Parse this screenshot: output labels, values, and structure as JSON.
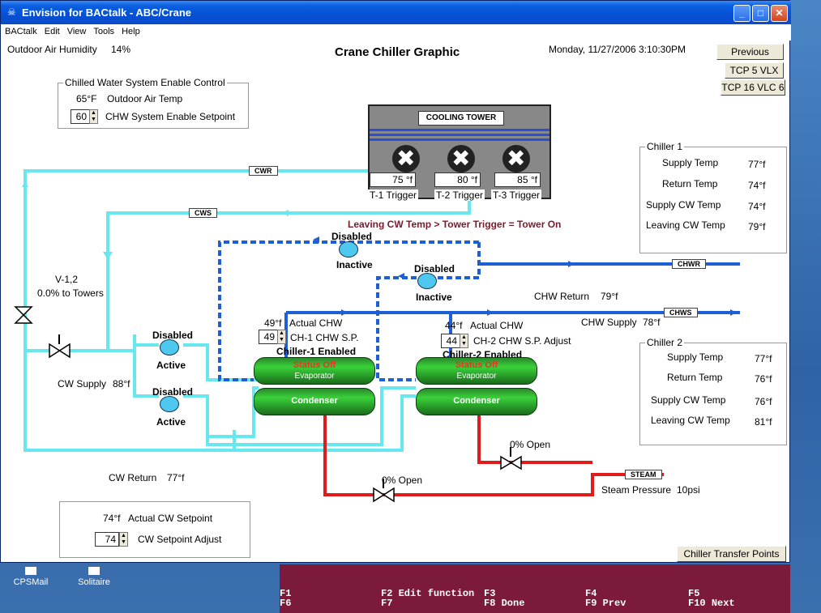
{
  "window": {
    "title": "Envision for BACtalk - ABC/Crane"
  },
  "menu": [
    "BACtalk",
    "Edit",
    "View",
    "Tools",
    "Help"
  ],
  "header": {
    "humidity_label": "Outdoor Air Humidity",
    "humidity_value": "14%",
    "graphic_title": "Crane Chiller Graphic",
    "datetime": "Monday, 11/27/2006  3:10:30PM"
  },
  "nav_buttons": {
    "previous": "Previous",
    "tcp5": "TCP 5 VLX",
    "tcp16": "TCP 16 VLC 6",
    "transfer": "Chiller Transfer Points"
  },
  "enable_control": {
    "legend": "Chilled Water System Enable Control",
    "oat": "65°F",
    "oat_label": "Outdoor Air Temp",
    "setpoint": "60",
    "setpoint_label": "CHW System Enable Setpoint"
  },
  "tower": {
    "title": "COOLING TOWER",
    "triggers": [
      {
        "value": "75",
        "unit": "°f",
        "label": "T-1 Trigger"
      },
      {
        "value": "80",
        "unit": "°f",
        "label": "T-2 Trigger"
      },
      {
        "value": "85",
        "unit": "°f",
        "label": "T-3 Trigger"
      }
    ],
    "rule": "Leaving CW Temp > Tower Trigger = Tower On"
  },
  "pipe_tags": {
    "cwr": "CWR",
    "cws": "CWS",
    "chwr": "CHWR",
    "chws": "CHWS",
    "steam": "STEAM"
  },
  "chiller1_panel": {
    "legend": "Chiller 1",
    "rows": [
      {
        "label": "Supply Temp",
        "value": "77°f"
      },
      {
        "label": "Return Temp",
        "value": "74°f"
      },
      {
        "label": "Supply CW Temp",
        "value": "74°f"
      },
      {
        "label": "Leaving CW Temp",
        "value": "79°f"
      }
    ]
  },
  "chiller2_panel": {
    "legend": "Chiller 2",
    "rows": [
      {
        "label": "Supply Temp",
        "value": "77°f"
      },
      {
        "label": "Return Temp",
        "value": "76°f"
      },
      {
        "label": "Supply CW Temp",
        "value": "76°f"
      },
      {
        "label": "Leaving CW Temp",
        "value": "81°f"
      }
    ]
  },
  "pumps": {
    "chw1_status": "Disabled",
    "chw1_state": "Inactive",
    "chw2_status": "Disabled",
    "chw2_state": "Inactive",
    "cw1_status": "Disabled",
    "cw1_state": "Active",
    "cw2_status": "Disabled",
    "cw2_state": "Active"
  },
  "valve": {
    "name": "V-1,2",
    "position": "0.0% to Towers"
  },
  "readings": {
    "chw_return_label": "CHW Return",
    "chw_return": "79°f",
    "chw_supply_label": "CHW Supply",
    "chw_supply": "78°f",
    "cw_supply_label": "CW Supply",
    "cw_supply": "88°f",
    "cw_return_label": "CW Return",
    "cw_return": "77°f",
    "steam_label": "Steam Pressure",
    "steam": "10psi",
    "valve1_open": "0% Open",
    "valve2_open": "0% Open"
  },
  "chiller1": {
    "actual_chw": "49°f",
    "actual_label": "Actual CHW",
    "sp": "49",
    "sp_label": "CH-1 CHW S.P.",
    "enabled": "Chiller-1 Enabled",
    "status": "Status Off",
    "evap": "Evaporator",
    "cond": "Condenser"
  },
  "chiller2": {
    "actual_chw": "44°f",
    "actual_label": "Actual CHW",
    "sp": "44",
    "sp_label": "CH-2 CHW S.P. Adjust",
    "enabled": "Chiller-2 Enabled",
    "status": "Status Off",
    "evap": "Evaporator",
    "cond": "Condenser"
  },
  "cw_setpoint": {
    "actual": "74°f",
    "actual_label": "Actual CW Setpoint",
    "adjust": "74",
    "adjust_label": "CW Setpoint Adjust"
  },
  "desktop": {
    "icon1": "CPSMail",
    "icon2": "Solitaire"
  },
  "function_keys": {
    "f1": "F1",
    "f2": "F2",
    "f2_label": "Edit function",
    "f3": "F3",
    "f4": "F4",
    "f5": "F5",
    "f6": "F6",
    "f7": "F7",
    "f8": "F8",
    "f8_label": "Done",
    "f9": "F9",
    "f9_label": "Prev",
    "f10": "F10",
    "f10_label": "Next"
  },
  "colors": {
    "cw_pipe": "#66e8ee",
    "chw_pipe": "#1f5fd6",
    "steam_pipe": "#e01b1b",
    "titlebar": "#0550d5"
  }
}
